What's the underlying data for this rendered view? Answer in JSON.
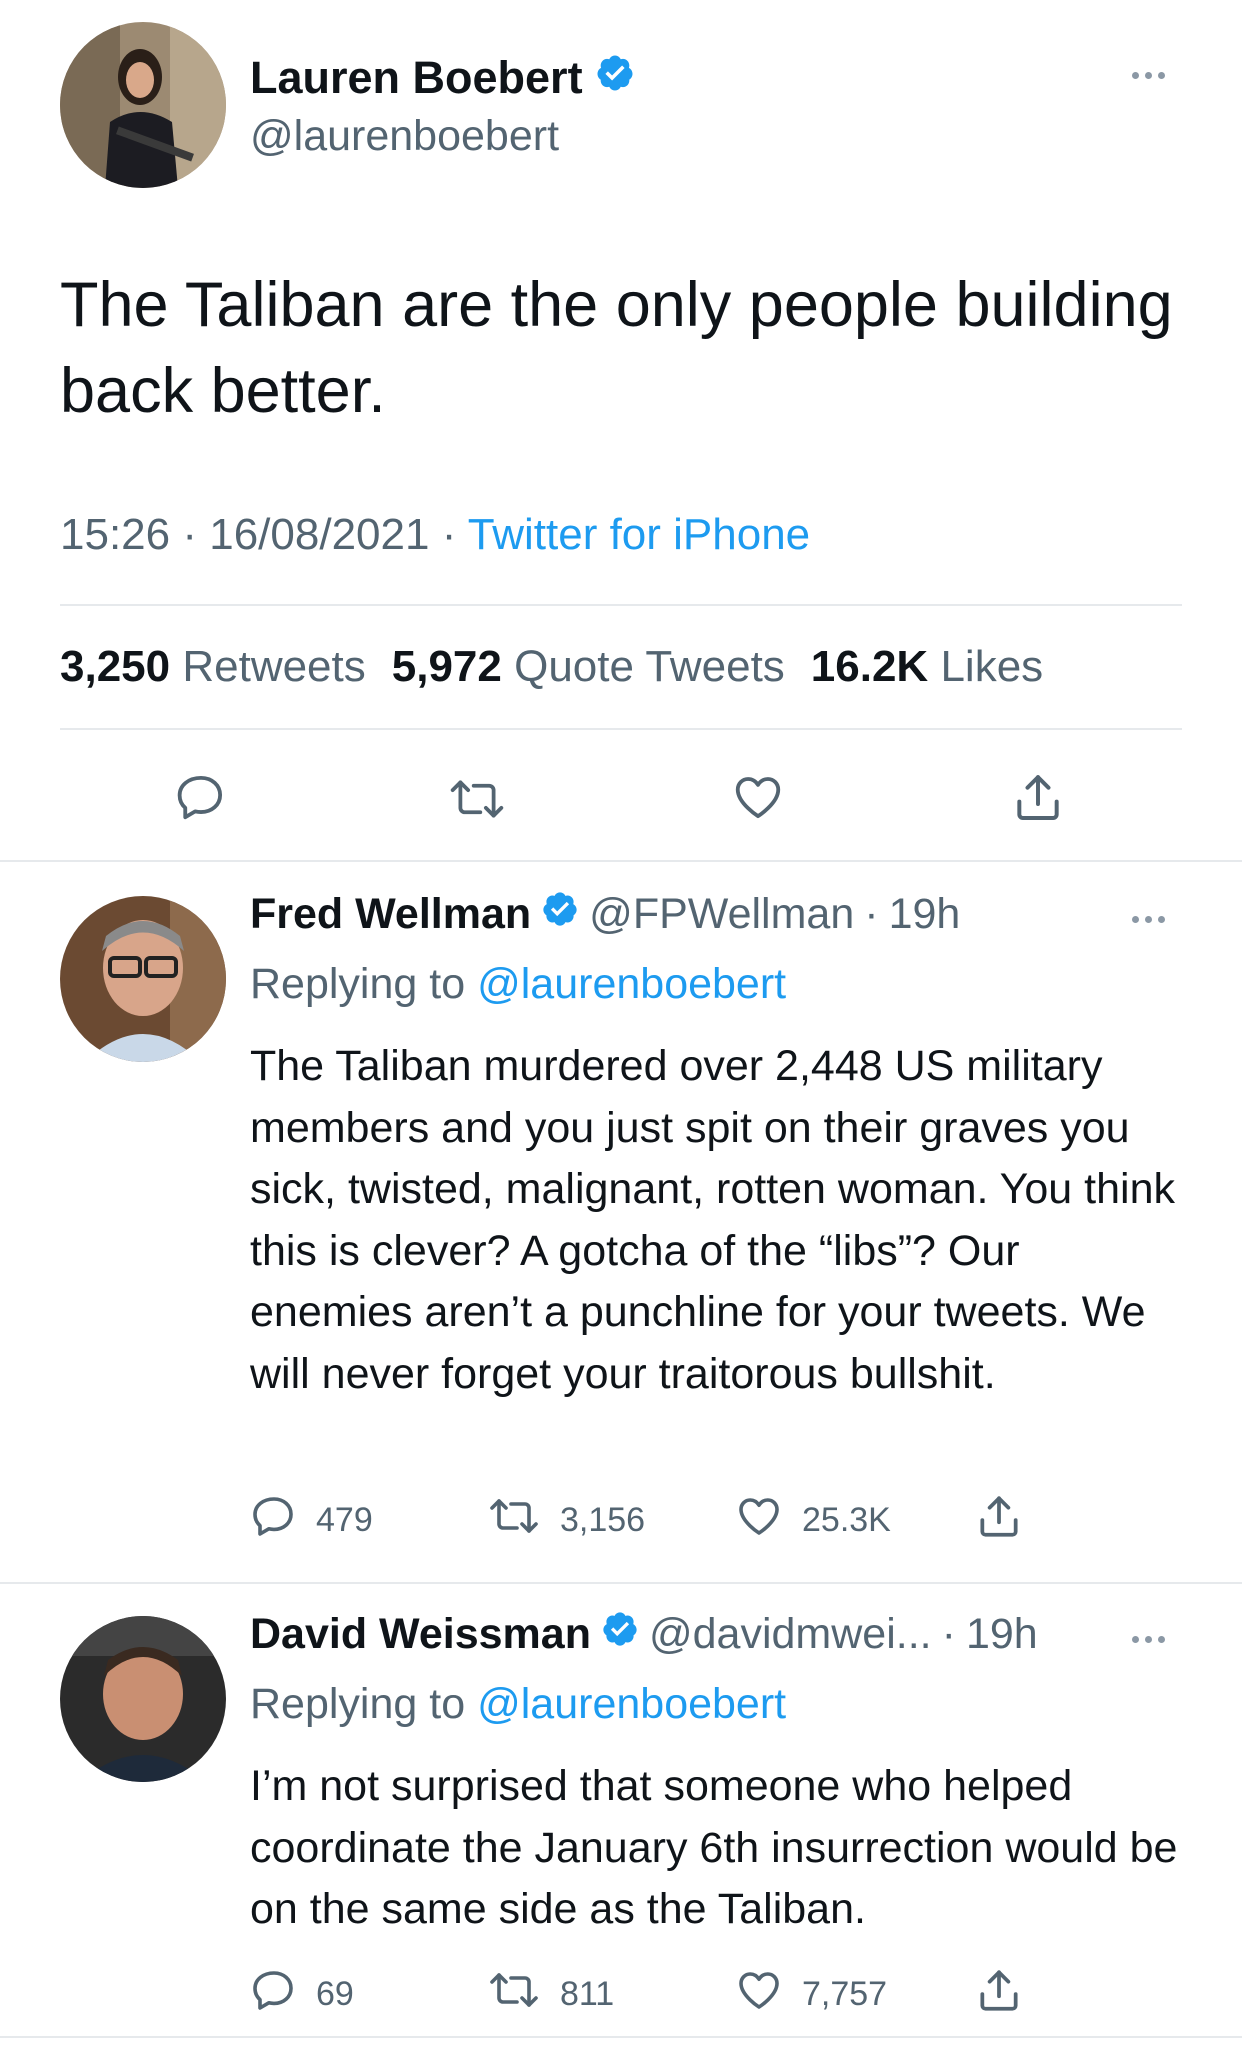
{
  "main_tweet": {
    "author_name": "Lauren Boebert",
    "author_handle": "@laurenboebert",
    "text": "The Taliban are the only people building back better.",
    "time": "15:26",
    "date": "16/08/2021",
    "separator": "·",
    "source": "Twitter for iPhone",
    "stats": {
      "retweets_count": "3,250",
      "retweets_label": "Retweets",
      "quotes_count": "5,972",
      "quotes_label": "Quote Tweets",
      "likes_count": "16.2K",
      "likes_label": "Likes"
    }
  },
  "replies": [
    {
      "author_name": "Fred Wellman",
      "author_handle": "@FPWellman",
      "time": "19h",
      "replying_prefix": "Replying to",
      "replying_to": "@laurenboebert",
      "text": "The Taliban murdered over 2,448 US military members and you just spit on their graves you sick, twisted, malignant, rotten woman. You think this is clever? A gotcha of the “libs”?   Our enemies aren’t a punchline for your tweets. We will never forget your traitorous bullshit.",
      "reply_count": "479",
      "retweet_count": "3,156",
      "like_count": "25.3K"
    },
    {
      "author_name": "David Weissman",
      "author_handle": "@davidmwei...",
      "time": "19h",
      "replying_prefix": "Replying to",
      "replying_to": "@laurenboebert",
      "text": "I’m not surprised that someone who helped coordinate the January 6th insurrection would be on the same side as the Taliban.",
      "reply_count": "69",
      "retweet_count": "811",
      "like_count": "7,757"
    }
  ],
  "colors": {
    "accent": "#1d9bf0",
    "secondary_text": "#536471",
    "primary_text": "#0f1419",
    "divider": "#e6e9ec"
  },
  "icons": [
    "verified-badge-icon",
    "more-icon",
    "reply-icon",
    "retweet-icon",
    "like-icon",
    "share-icon"
  ]
}
